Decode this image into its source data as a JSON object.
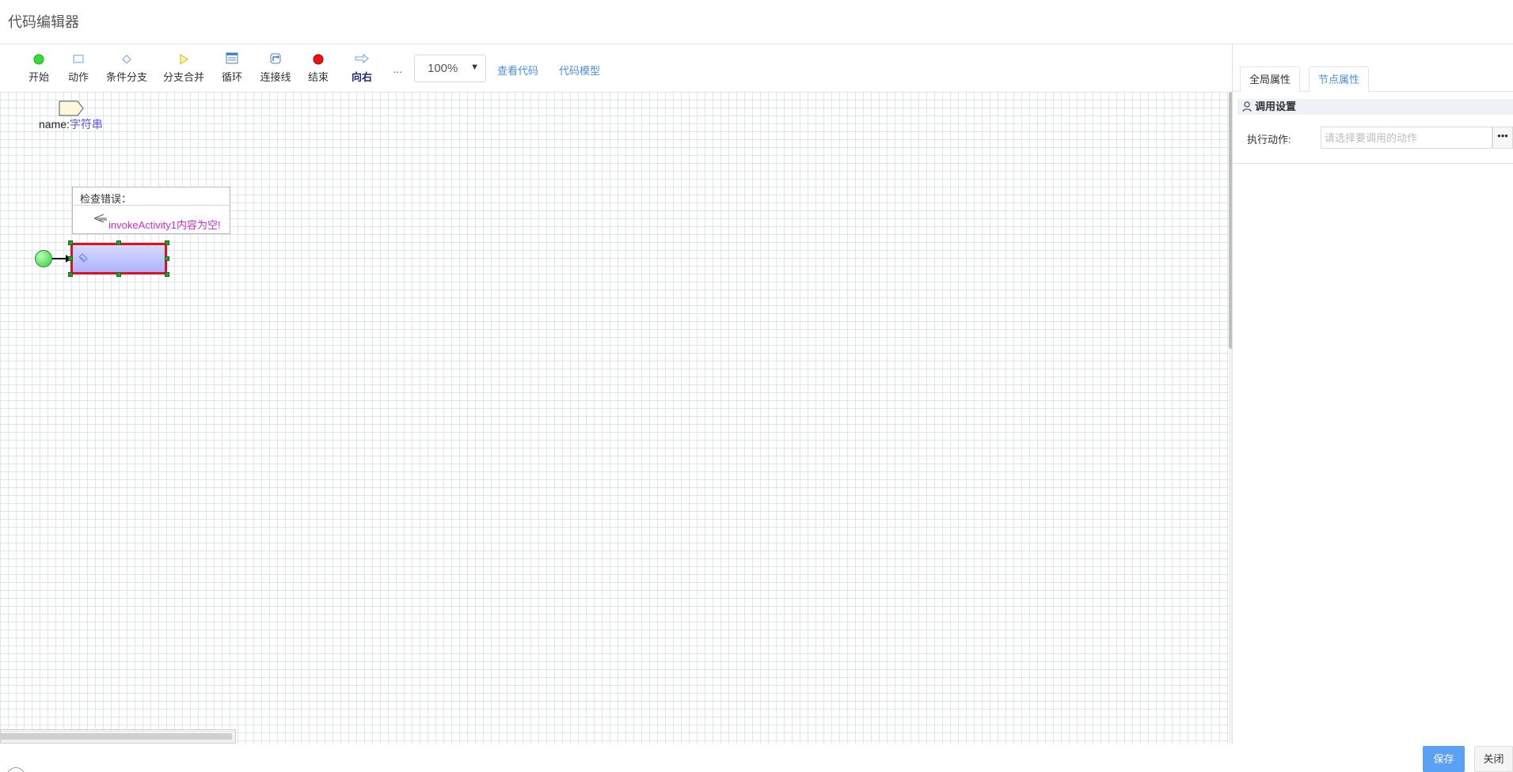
{
  "window": {
    "title": "代码编辑器"
  },
  "toolbar": {
    "tools": [
      {
        "label": "开始",
        "icon": "start-circle-icon",
        "color": "#33dd33"
      },
      {
        "label": "动作",
        "icon": "action-rect-icon",
        "color": "#6aa0e8"
      },
      {
        "label": "条件分支",
        "icon": "condition-diamond-icon",
        "color": "#6aa0e8"
      },
      {
        "label": "分支合并",
        "icon": "merge-triangle-icon",
        "color": "#f0c419"
      },
      {
        "label": "循环",
        "icon": "loop-icon",
        "color": "#6aa0e8"
      },
      {
        "label": "连接线",
        "icon": "connect-icon",
        "color": "#6aa0e8"
      },
      {
        "label": "结束",
        "icon": "end-circle-icon",
        "color": "#ee1111"
      },
      {
        "label": "向右",
        "icon": "arrow-right-icon",
        "color": "#6aa0e8"
      }
    ],
    "more": "...",
    "zoom": "100%",
    "view_code": "查看代码",
    "code_model": "代码模型"
  },
  "canvas": {
    "param": {
      "name": "name:",
      "type": "字符串"
    },
    "error": {
      "title": "检查错误：",
      "message": "invokeActivity1内容为空!"
    }
  },
  "panel": {
    "tabs": [
      {
        "label": "全局属性",
        "active": false
      },
      {
        "label": "节点属性",
        "active": true
      }
    ],
    "section": "调用设置",
    "field_label": "执行动作:",
    "field_placeholder": "请选择要调用的动作",
    "field_button": "•••"
  },
  "footer": {
    "save": "保存",
    "close": "关闭"
  },
  "colors": {
    "accent": "#4a90e2",
    "error": "#e0101c",
    "save": "#5aa0f5"
  }
}
